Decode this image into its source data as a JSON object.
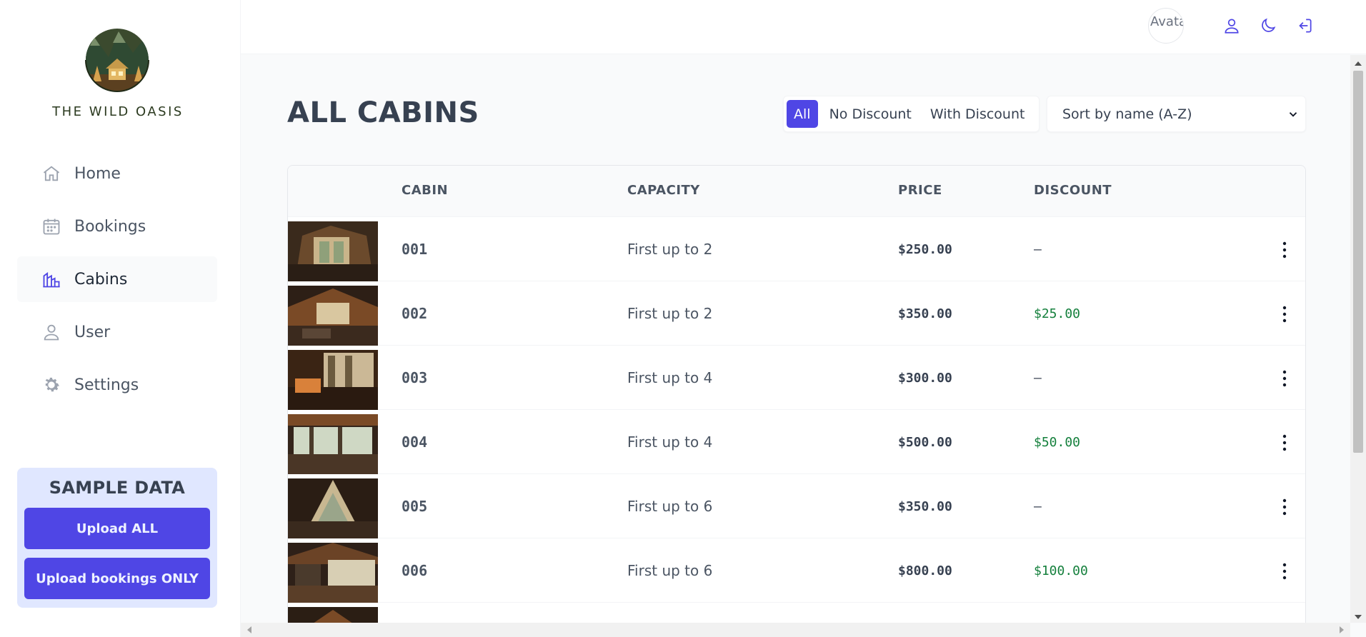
{
  "sidebar": {
    "brand": "THE WILD OASIS",
    "items": [
      {
        "label": "Home",
        "icon": "home-icon"
      },
      {
        "label": "Bookings",
        "icon": "calendar-icon"
      },
      {
        "label": "Cabins",
        "icon": "cabins-icon"
      },
      {
        "label": "User",
        "icon": "user-icon"
      },
      {
        "label": "Settings",
        "icon": "gear-icon"
      }
    ],
    "active": "Cabins",
    "sample": {
      "title": "SAMPLE DATA",
      "upload_all": "Upload ALL",
      "upload_bookings": "Upload bookings ONLY"
    }
  },
  "header": {
    "avatar_alt": "Avatar",
    "icons": [
      "user-icon",
      "moon-icon",
      "logout-icon"
    ]
  },
  "main": {
    "title": "ALL CABINS",
    "filters": [
      "All",
      "No Discount",
      "With Discount"
    ],
    "active_filter": "All",
    "sort_value": "Sort by name (A-Z)",
    "columns": [
      "CABIN",
      "CAPACITY",
      "PRICE",
      "DISCOUNT"
    ],
    "rows": [
      {
        "name": "001",
        "capacity": "First up to 2",
        "price": "$250.00",
        "discount": "—"
      },
      {
        "name": "002",
        "capacity": "First up to 2",
        "price": "$350.00",
        "discount": "$25.00"
      },
      {
        "name": "003",
        "capacity": "First up to 4",
        "price": "$300.00",
        "discount": "—"
      },
      {
        "name": "004",
        "capacity": "First up to 4",
        "price": "$500.00",
        "discount": "$50.00"
      },
      {
        "name": "005",
        "capacity": "First up to 6",
        "price": "$350.00",
        "discount": "—"
      },
      {
        "name": "006",
        "capacity": "First up to 6",
        "price": "$800.00",
        "discount": "$100.00"
      }
    ]
  },
  "colors": {
    "accent": "#4f46e5",
    "discount": "#15803d",
    "sample_bg": "#e0e7ff"
  }
}
